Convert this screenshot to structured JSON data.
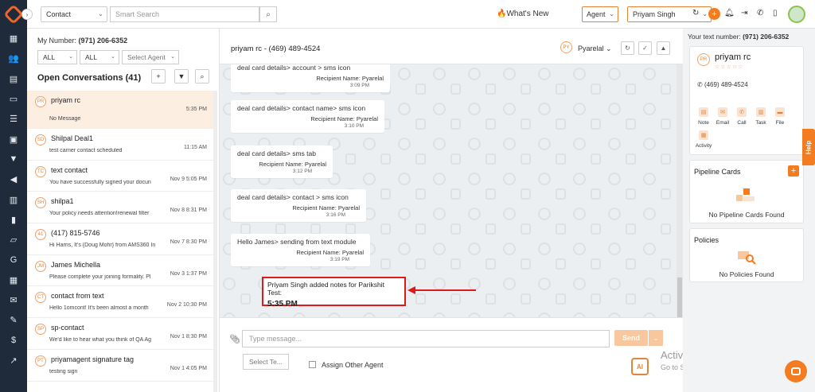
{
  "topbar": {
    "contact_select": "Contact",
    "search_placeholder": "Smart Search",
    "whats_new": "What's New",
    "agent_select": "Agent",
    "user_select": "Priyam Singh"
  },
  "left_panel": {
    "my_number_label": "My Number:",
    "my_number": "(971) 206-6352",
    "filter1": "ALL",
    "filter2": "ALL",
    "filter3": "Select Agent",
    "title": "Open Conversations (41)",
    "conversations": [
      {
        "initials": "PR",
        "name": "priyam rc",
        "time": "5:35 PM",
        "preview": "No Message"
      },
      {
        "initials": "SD",
        "name": "Shilpal Deal1",
        "time": "11:15 AM",
        "preview": "test carrier contact scheduled"
      },
      {
        "initials": "TC",
        "name": "text contact",
        "time": "Nov 9 5:05 PM",
        "preview": "You have successfully signed your docun"
      },
      {
        "initials": "SH",
        "name": "shilpa1",
        "time": "Nov 8 8:31 PM",
        "preview": "Your policy needs attention!renewal filter"
      },
      {
        "initials": "41",
        "name": "(417) 815-5746",
        "time": "Nov 7 8:30 PM",
        "preview": "Hi Harris, It's {Doug Mohr} from AMS360 In"
      },
      {
        "initials": "JM",
        "name": "James Michella",
        "time": "Nov 3 1:37 PM",
        "preview": "Please complete your joining formality. Pl"
      },
      {
        "initials": "CT",
        "name": "contact from text",
        "time": "Nov 2 10:30 PM",
        "preview": "Hello 1omcont! It's been almost a month"
      },
      {
        "initials": "SP",
        "name": "sp-contact",
        "time": "Nov 1 8:30 PM",
        "preview": "We'd like to hear what you think of QA Ag"
      },
      {
        "initials": "PT",
        "name": "priyamagent signature tag",
        "time": "Nov 1 4:05 PM",
        "preview": "testing sign"
      }
    ]
  },
  "chat": {
    "title": "priyam rc - (469) 489-4524",
    "agent_initials": "PY",
    "agent_name": "Pyarelal",
    "messages": [
      {
        "text": "deal card details> account > sms icon",
        "recipient": "Recipient Name: Pyarelal",
        "time": "3:09 PM"
      },
      {
        "text": "deal card details> contact name> sms icon",
        "recipient": "Recipient Name: Pyarelal",
        "time": "3:10 PM"
      },
      {
        "text": "deal card details> sms tab",
        "recipient": "Recipient Name: Pyarelal",
        "time": "3:12 PM"
      },
      {
        "text": "deal card details> contact > sms icon",
        "recipient": "Recipient Name: Pyarelal",
        "time": "3:16 PM"
      },
      {
        "text": "Hello James> sending from text module",
        "recipient": "Recipient Name: Pyarelal",
        "time": "3:19 PM"
      }
    ],
    "note_text": "Priyam Singh added notes for Parikshit Test:",
    "note_time": "5:35 PM",
    "compose_placeholder": "Type message...",
    "send_label": "Send",
    "select_template": "Select Te...",
    "assign_label": "Assign Other Agent",
    "ai_label": "AI",
    "activate_line1": "Activate Windows",
    "activate_line2": "Go to Settings to activate Windows."
  },
  "right_panel": {
    "your_number_label": "Your text number:",
    "your_number": "(971) 206-6352",
    "contact_initials": "PR",
    "contact_name": "priyam rc",
    "contact_stars": "☆☆☆☆☆",
    "contact_phone": "(469) 489-4524",
    "actions": [
      "Note",
      "Email",
      "Call",
      "Task",
      "File",
      "Activity"
    ],
    "pipeline_title": "Pipeline Cards",
    "pipeline_empty": "No Pipeline Cards Found",
    "policies_title": "Policies",
    "policies_empty": "No Policies Found",
    "help_label": "Help"
  },
  "colors": {
    "accent": "#f47c20",
    "sidebar": "#1f2a3a",
    "highlight": "#e01919"
  }
}
